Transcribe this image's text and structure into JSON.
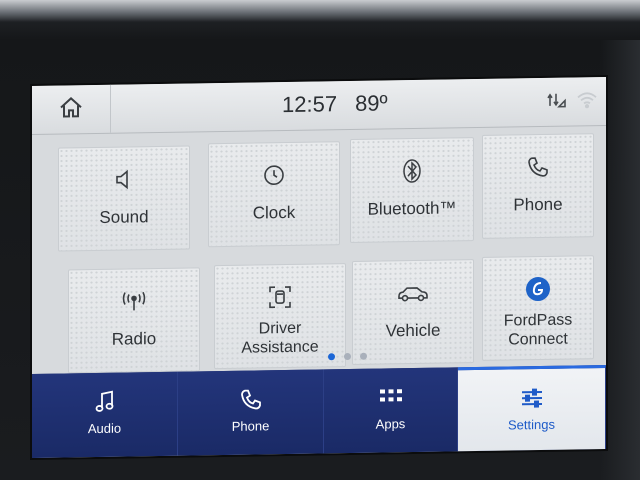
{
  "status": {
    "time": "12:57",
    "temperature": "89º"
  },
  "tiles": [
    {
      "label": "Sound",
      "icon": "speaker-icon"
    },
    {
      "label": "Clock",
      "icon": "clock-icon"
    },
    {
      "label": "Bluetooth™",
      "icon": "bluetooth-icon"
    },
    {
      "label": "Phone",
      "icon": "phone-icon"
    },
    {
      "label": "Radio",
      "icon": "radio-antenna-icon"
    },
    {
      "label": "Driver\nAssistance",
      "icon": "driver-assist-icon"
    },
    {
      "label": "Vehicle",
      "icon": "car-icon"
    },
    {
      "label": "FordPass\nConnect",
      "icon": "fordpass-icon"
    }
  ],
  "page_indicator": {
    "count": 3,
    "active": 1
  },
  "bottom_nav": [
    {
      "label": "Audio",
      "icon": "music-note-icon",
      "selected": false
    },
    {
      "label": "Phone",
      "icon": "phone-icon",
      "selected": false
    },
    {
      "label": "Apps",
      "icon": "apps-grid-icon",
      "selected": false
    },
    {
      "label": "Settings",
      "icon": "settings-sliders-icon",
      "selected": true
    }
  ],
  "colors": {
    "nav_background": "#1f2f6f",
    "selected_accent": "#2a6ae0",
    "tile_text": "#2f3337"
  }
}
